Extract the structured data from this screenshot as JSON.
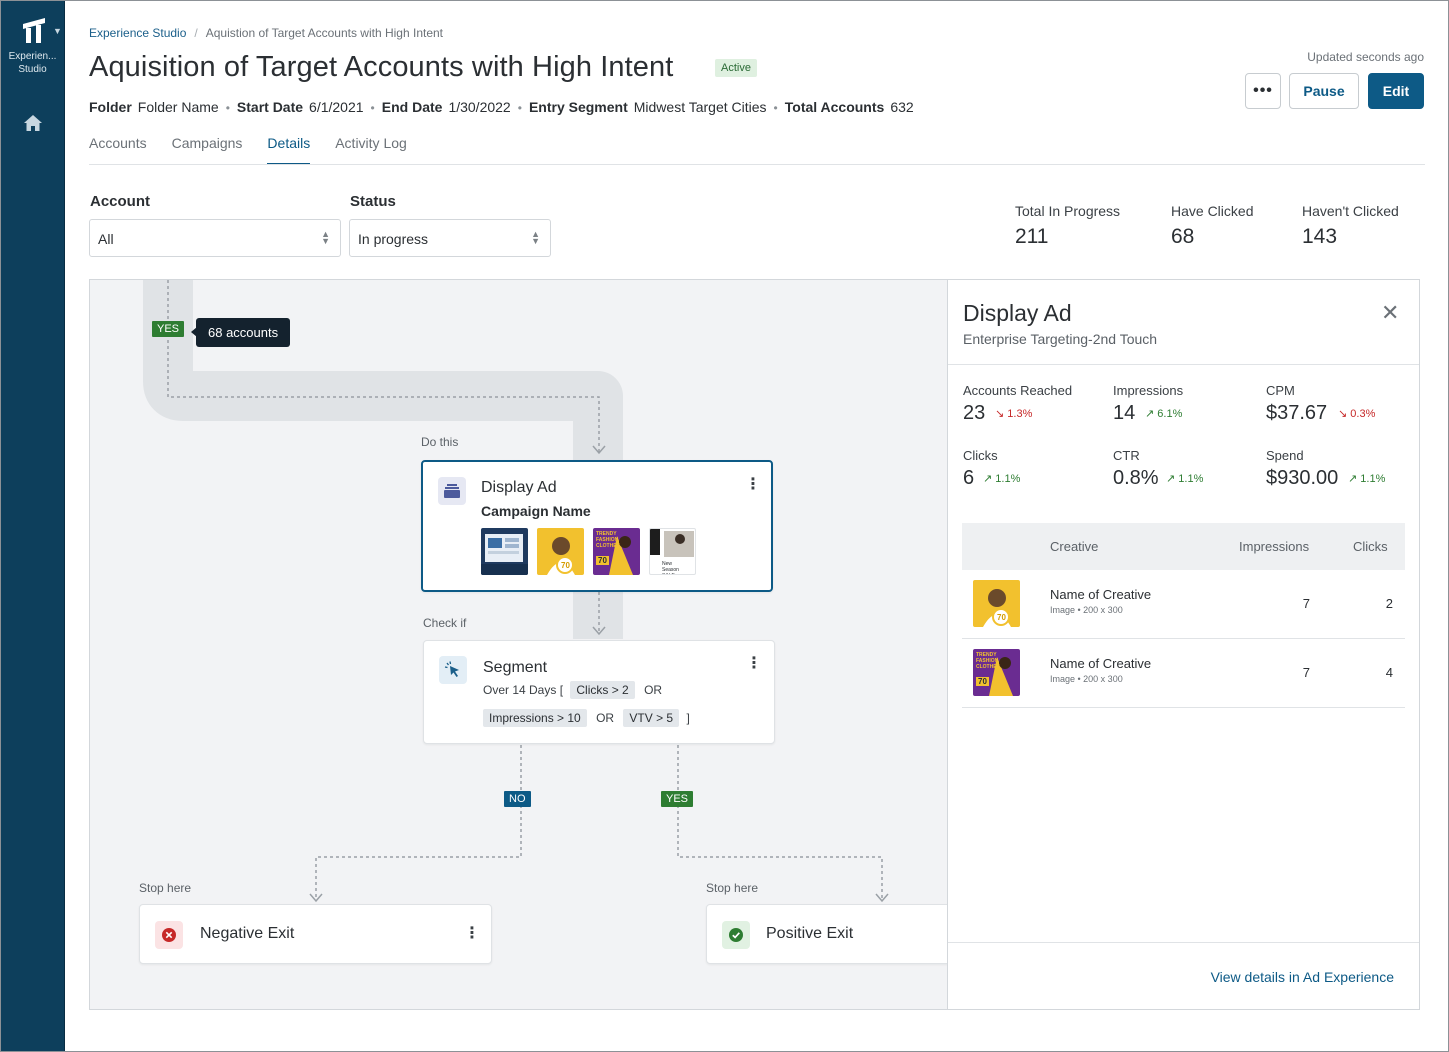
{
  "nav": {
    "app_label_line1": "Experien...",
    "app_label_line2": "Studio"
  },
  "breadcrumb": {
    "root": "Experience Studio",
    "separator": "/",
    "current": "Aquistion of Target Accounts with High Intent"
  },
  "header": {
    "title": "Aquisition of Target Accounts with High Intent",
    "status_badge": "Active",
    "updated": "Updated seconds ago",
    "more_label": "•••",
    "pause_label": "Pause",
    "edit_label": "Edit",
    "meta": [
      {
        "label": "Folder",
        "value": "Folder Name"
      },
      {
        "label": "Start Date",
        "value": "6/1/2021"
      },
      {
        "label": "End Date",
        "value": "1/30/2022"
      },
      {
        "label": "Entry Segment",
        "value": "Midwest Target Cities"
      },
      {
        "label": "Total Accounts",
        "value": "632"
      }
    ],
    "meta_separator": "•"
  },
  "tabs": [
    "Accounts",
    "Campaigns",
    "Details",
    "Activity Log"
  ],
  "active_tab": "Details",
  "filters": {
    "account_label": "Account",
    "account_value": "All",
    "status_label": "Status",
    "status_value": "In progress"
  },
  "kpis": [
    {
      "label": "Total In Progress",
      "value": "211"
    },
    {
      "label": "Have Clicked",
      "value": "68"
    },
    {
      "label": "Haven't Clicked",
      "value": "143"
    }
  ],
  "flow": {
    "top_yes_tag": "YES",
    "tooltip": "68 accounts",
    "do_this_label": "Do this",
    "display_card": {
      "title": "Display Ad",
      "subtitle": "Campaign Name",
      "kebab": "⋮",
      "thumb3_text": "TRENDY FASHION CLOTHES",
      "thumb3_badge": "70",
      "thumb2_badge": "70",
      "thumb4_text": "New Season SALE"
    },
    "check_if_label": "Check if",
    "segment_card": {
      "title": "Segment",
      "kebab": "⋮",
      "line1_prefix": "Over 14 Days [",
      "chip_clicks": "Clicks > 2",
      "or1": "OR",
      "chip_impressions": "Impressions > 10",
      "or2": "OR",
      "chip_vtv": "VTV > 5",
      "close_bracket": "]"
    },
    "no_tag": "NO",
    "yes_tag": "YES",
    "stop_here_left": "Stop here",
    "stop_here_right": "Stop here",
    "negative_exit": {
      "title": "Negative Exit",
      "kebab": "⋮"
    },
    "positive_exit": {
      "title": "Positive Exit"
    }
  },
  "panel": {
    "title": "Display Ad",
    "subtitle": "Enterprise Targeting-2nd Touch",
    "close": "✕",
    "metrics": [
      {
        "label": "Accounts Reached",
        "value": "23",
        "delta": "↘ 1.3%",
        "trend": "down"
      },
      {
        "label": "Impressions",
        "value": "14",
        "delta": "↗ 6.1%",
        "trend": "up"
      },
      {
        "label": "CPM",
        "value": "$37.67",
        "delta": "↘ 0.3%",
        "trend": "down"
      },
      {
        "label": "Clicks",
        "value": "6",
        "delta": "↗ 1.1%",
        "trend": "up"
      },
      {
        "label": "CTR",
        "value": "0.8%",
        "delta": "↗ 1.1%",
        "trend": "up"
      },
      {
        "label": "Spend",
        "value": "$930.00",
        "delta": "↗ 1.1%",
        "trend": "up"
      }
    ],
    "table": {
      "headers": [
        "Creative",
        "Impressions",
        "Clicks"
      ],
      "rows": [
        {
          "name": "Name of Creative",
          "meta": "Image • 200 x 300",
          "impressions": "7",
          "clicks": "2",
          "badge": "70"
        },
        {
          "name": "Name of Creative",
          "meta": "Image • 200 x 300",
          "impressions": "7",
          "clicks": "4",
          "badge": "70",
          "text": "TRENDY FASHION CLOTHES"
        }
      ]
    },
    "footer_link": "View details in Ad Experience"
  },
  "colors": {
    "rail": "#0d3f5c",
    "accent": "#0d5a86",
    "positive": "#2e7d32",
    "negative": "#c62828",
    "canvas": "#f2f3f5"
  },
  "icons": [
    "brand-logo-icon",
    "home-icon",
    "more-icon",
    "display-ad-icon",
    "segment-cursor-icon",
    "negative-exit-icon",
    "positive-exit-icon",
    "close-icon",
    "select-caret-icon",
    "kebab-icon"
  ]
}
